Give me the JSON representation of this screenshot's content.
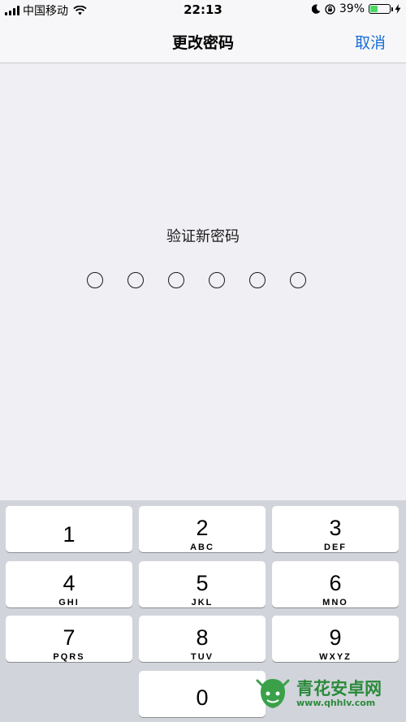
{
  "status_bar": {
    "carrier": "中国移动",
    "time": "22:13",
    "battery_percent": "39%",
    "battery_level": 0.39,
    "battery_fill_color": "#4cd964",
    "icons": [
      "signal-icon",
      "wifi-icon",
      "moon-icon",
      "orientation-lock-icon",
      "battery-icon",
      "charging-icon"
    ]
  },
  "nav": {
    "title": "更改密码",
    "cancel_label": "取消",
    "accent_color": "#1a6dd6"
  },
  "passcode": {
    "prompt": "验证新密码",
    "digit_count": 6,
    "entered": 0
  },
  "keypad": {
    "keys": [
      {
        "num": "1",
        "letters": ""
      },
      {
        "num": "2",
        "letters": "ABC"
      },
      {
        "num": "3",
        "letters": "DEF"
      },
      {
        "num": "4",
        "letters": "GHI"
      },
      {
        "num": "5",
        "letters": "JKL"
      },
      {
        "num": "6",
        "letters": "MNO"
      },
      {
        "num": "7",
        "letters": "PQRS"
      },
      {
        "num": "8",
        "letters": "TUV"
      },
      {
        "num": "9",
        "letters": "WXYZ"
      },
      {
        "num": "0",
        "letters": ""
      }
    ]
  },
  "watermark": {
    "text": "青花安卓网",
    "url": "www.qhhlv.com"
  }
}
